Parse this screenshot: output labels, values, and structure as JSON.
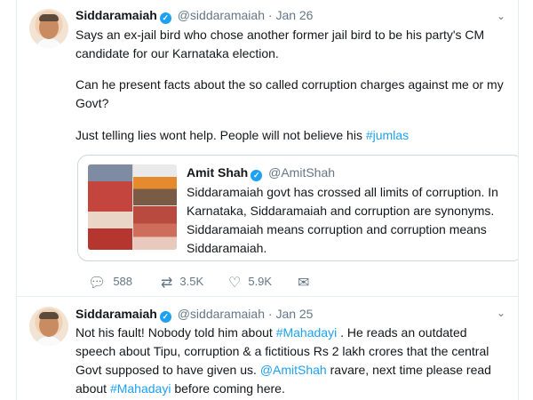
{
  "tweets": [
    {
      "name": "Siddaramaiah",
      "verified_mark": "✓",
      "handle": "@siddaramaiah",
      "separator": "·",
      "date": "Jan 26",
      "menu_icon": "chevron-down-icon",
      "para1": "Says an ex-jail bird who chose another former jail bird to be his party's CM candidate for our Karnataka election.",
      "para2": "Can he present facts about the so called corruption charges against me or my Govt?",
      "para3_text": "Just telling lies wont help. People will not believe his ",
      "para3_link": "#jumlas",
      "quoted": {
        "name": "Amit Shah",
        "verified_mark": "✓",
        "handle": "@AmitShah",
        "text": "Siddaramaiah govt has crossed all limits of corruption. In Karnataka, Siddaramaiah and corruption are synonyms. Siddaramaiah means corruption and corruption means Siddaramaiah."
      },
      "actions": {
        "reply_count": "588",
        "retweet_count": "3.5K",
        "like_count": "5.9K",
        "reply_icon": "reply-icon",
        "retweet_icon": "retweet-icon",
        "like_icon": "heart-icon",
        "dm_icon": "envelope-icon"
      }
    },
    {
      "name": "Siddaramaiah",
      "verified_mark": "✓",
      "handle": "@siddaramaiah",
      "separator": "·",
      "date": "Jan 25",
      "menu_icon": "chevron-down-icon",
      "seg1": "Not his fault! Nobody told him about ",
      "link1": "#Mahadayi",
      "seg2": " . He reads an outdated speech about Tipu, corruption & a fictitious Rs  2 lakh crores that the central Govt supposed to have given us. ",
      "link2": "@AmitShah",
      "seg3": " ravare, next time please read about ",
      "link3": "#Mahadayi",
      "seg4": " before coming here."
    }
  ],
  "colors": {
    "link": "#1da1f2",
    "secondary_text": "#657786",
    "border": "#e6ecf0"
  }
}
